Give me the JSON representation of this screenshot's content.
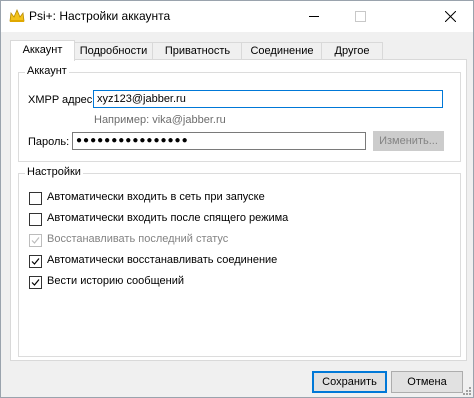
{
  "window": {
    "title": "Psi+: Настройки аккаунта",
    "icon": "psi-flower-icon",
    "controls": [
      "minimize-icon",
      "maximize-icon",
      "close-icon"
    ]
  },
  "tabs": [
    {
      "label": "Аккаунт",
      "active": true
    },
    {
      "label": "Подробности",
      "active": false
    },
    {
      "label": "Приватность",
      "active": false
    },
    {
      "label": "Соединение",
      "active": false
    },
    {
      "label": "Другое",
      "active": false
    }
  ],
  "account_group": {
    "title": "Аккаунт",
    "xmpp_label": "XMPP адрес:",
    "xmpp_value": "xyz123@jabber.ru",
    "xmpp_hint": "Например: vika@jabber.ru",
    "password_label": "Пароль:",
    "password_value": "●●●●●●●●●●●●●●●●",
    "change_button": "Изменить..."
  },
  "settings_group": {
    "title": "Настройки",
    "options": [
      {
        "label": "Автоматически входить в сеть при запуске",
        "checked": false,
        "enabled": true
      },
      {
        "label": "Автоматически входить после спящего режима",
        "checked": false,
        "enabled": true
      },
      {
        "label": "Восстанавливать последний статус",
        "checked": true,
        "enabled": false
      },
      {
        "label": "Автоматически восстанавливать соединение",
        "checked": true,
        "enabled": true
      },
      {
        "label": "Вести историю сообщений",
        "checked": true,
        "enabled": true
      }
    ]
  },
  "footer": {
    "save_button": "Сохранить",
    "cancel_button": "Отмена"
  },
  "colors": {
    "focus": "#0078d7",
    "disabled_text": "#838383"
  }
}
